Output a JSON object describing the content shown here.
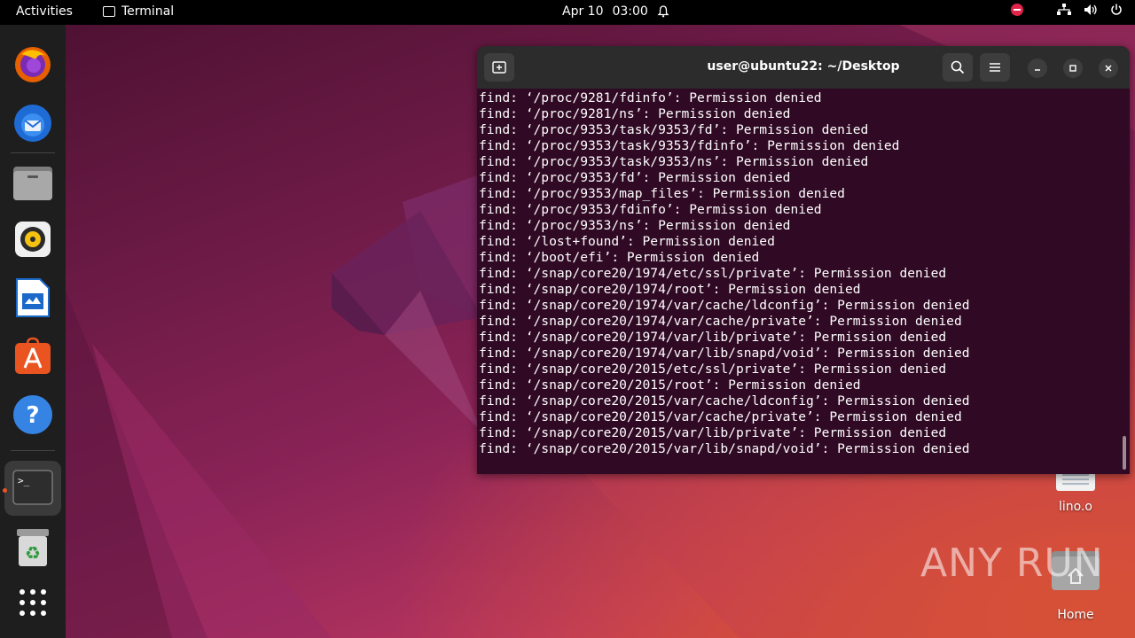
{
  "topbar": {
    "activities": "Activities",
    "app_name": "Terminal",
    "date": "Apr 10",
    "time": "03:00"
  },
  "dock": {
    "items": [
      "firefox-icon",
      "thunderbird-icon",
      "files-icon",
      "rhythmbox-icon",
      "libreoffice-writer-icon",
      "app-center-icon",
      "help-icon",
      "terminal-icon",
      "trash-icon",
      "show-apps-icon"
    ]
  },
  "terminal": {
    "title": "user@ubuntu22: ~/Desktop",
    "lines": [
      "find: ‘/proc/9281/fdinfo’: Permission denied",
      "find: ‘/proc/9281/ns’: Permission denied",
      "find: ‘/proc/9353/task/9353/fd’: Permission denied",
      "find: ‘/proc/9353/task/9353/fdinfo’: Permission denied",
      "find: ‘/proc/9353/task/9353/ns’: Permission denied",
      "find: ‘/proc/9353/fd’: Permission denied",
      "find: ‘/proc/9353/map_files’: Permission denied",
      "find: ‘/proc/9353/fdinfo’: Permission denied",
      "find: ‘/proc/9353/ns’: Permission denied",
      "find: ‘/lost+found’: Permission denied",
      "find: ‘/boot/efi’: Permission denied",
      "find: ‘/snap/core20/1974/etc/ssl/private’: Permission denied",
      "find: ‘/snap/core20/1974/root’: Permission denied",
      "find: ‘/snap/core20/1974/var/cache/ldconfig’: Permission denied",
      "find: ‘/snap/core20/1974/var/cache/private’: Permission denied",
      "find: ‘/snap/core20/1974/var/lib/private’: Permission denied",
      "find: ‘/snap/core20/1974/var/lib/snapd/void’: Permission denied",
      "find: ‘/snap/core20/2015/etc/ssl/private’: Permission denied",
      "find: ‘/snap/core20/2015/root’: Permission denied",
      "find: ‘/snap/core20/2015/var/cache/ldconfig’: Permission denied",
      "find: ‘/snap/core20/2015/var/cache/private’: Permission denied",
      "find: ‘/snap/core20/2015/var/lib/private’: Permission denied",
      "find: ‘/snap/core20/2015/var/lib/snapd/void’: Permission denied"
    ]
  },
  "desktop": {
    "icons": [
      {
        "label": "lino.o",
        "icon": "text-file-icon"
      },
      {
        "label": "Home",
        "icon": "home-folder-icon"
      }
    ],
    "watermark": "ANY RUN"
  },
  "colors": {
    "terminal_bg": "#300a24",
    "accent": "#e95420"
  }
}
